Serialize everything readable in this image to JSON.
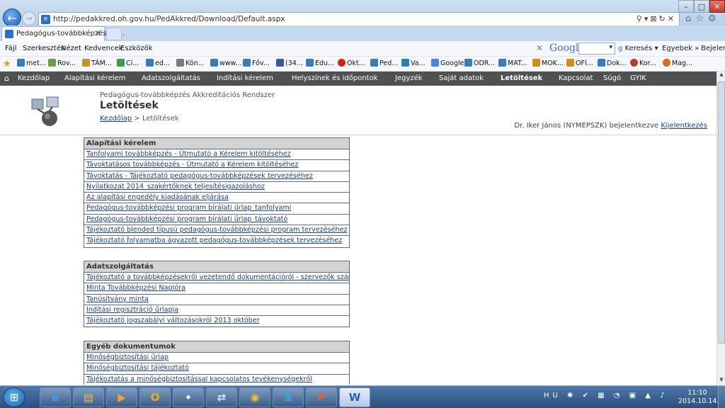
{
  "browser": {
    "url": "http://pedakkred.oh.gov.hu/PedAkkred/Download/Default.aspx",
    "tab_title": "Pedagógus-továbbképzés Ak...",
    "menu": [
      "Fájl",
      "Szerkesztés",
      "Nézet",
      "Kedvencek",
      "Eszközök"
    ],
    "google_label": "Google",
    "search_label": "Keresés",
    "more_label": "Egyebek »",
    "login_label": "Bejelentk",
    "favorites": [
      "met...",
      "Rov...",
      "TÁM...",
      "Cí...",
      "ed...",
      "Kön...",
      "www...",
      "Főv...",
      "(34...",
      "Edu...",
      "Okt...",
      "Ped...",
      "Va...",
      "Google",
      "ODR...",
      "MAT...",
      "MOK...",
      "OFI...",
      "Dok...",
      "Kor...",
      "Mag..."
    ]
  },
  "site_nav": [
    "Kezdőlap",
    "Alapítási kérelem",
    "Adatszolgáltatás",
    "Indítási kérelem",
    "Helyszínek és időpontok",
    "Jegyzék",
    "Saját adatok",
    "Letöltések",
    "Kapcsolat",
    "Súgó",
    "GYIK"
  ],
  "header": {
    "subtitle": "Pedagógus-továbbképzés Akkreditációs Rendszer",
    "title": "Letöltések",
    "breadcrumb_home": "Kezdőlap",
    "breadcrumb_sep": " > ",
    "breadcrumb_current": "Letöltések",
    "user_text": "Dr. Iker János (NYMEPSZK) bejelentkezve",
    "logout": "Kijelentkezés"
  },
  "sections": [
    {
      "title": "Alapítási kérelem",
      "items": [
        "Tanfolyami továbbképzés - Útmutató a Kérelem kitöltéséhez",
        "Távoktatásos továbbképzés - Útmutató a Kérelem kitöltéséhez",
        "Távoktatás - Tájékoztató pedagógus-továbbképzések tervezéséhez",
        "Nyilatkozat 2014_szakértőknek teljesítésigazoláshoz",
        "Az alapítási engedély kiadásának eljárása",
        "Pedagógus-továbbképzési program bírálati űrlap_tanfolyami",
        "Pedagógus-továbbképzési program bírálati űrlap_távoktató",
        "Tájékoztató blended típusú pedagógus-továbbképzési program tervezéséhez",
        "Tájékoztató folyamatba ágyazott pedagógus-továbbképzések tervezéséhez"
      ]
    },
    {
      "title": "Adatszolgáltatás",
      "items": [
        "Tájékoztató a továbbképzésekről vezetendő dokumentációról - szervezők számára",
        "Minta Továbbképzési Naplóra",
        "Tanúsítvány minta",
        "Indítási regisztráció űrlapja",
        "Tájékoztató jogszabályi változásokról 2013 október"
      ]
    },
    {
      "title": "Egyéb dokumentumok",
      "items": [
        "Minőségbiztosítási űrlap",
        "Minőségbiztosítási tájékoztató",
        "Tájékoztatás a minőségbiztosítással kapcsolatos tevékenységekről"
      ]
    }
  ],
  "taskbar": {
    "lang": "HU",
    "time": "11:10",
    "date": "2014.10.14."
  }
}
